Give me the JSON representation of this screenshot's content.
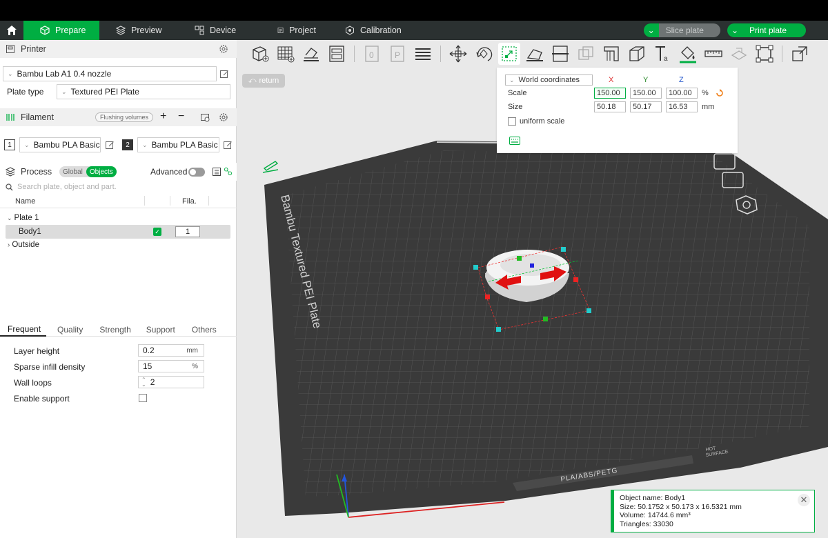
{
  "nav": {
    "tabs": [
      {
        "label": "Prepare"
      },
      {
        "label": "Preview"
      },
      {
        "label": "Device"
      },
      {
        "label": "Project"
      },
      {
        "label": "Calibration"
      }
    ],
    "slice_label": "Slice plate",
    "print_label": "Print plate"
  },
  "printer": {
    "title": "Printer",
    "model": "Bambu Lab A1 0.4 nozzle",
    "plate_type_label": "Plate type",
    "plate_type": "Textured PEI Plate"
  },
  "filament": {
    "title": "Filament",
    "flushing_label": "Flushing volumes",
    "plus": "+",
    "minus": "−",
    "slots": [
      {
        "num": "1",
        "name": "Bambu PLA Basic"
      },
      {
        "num": "2",
        "name": "Bambu PLA Basic"
      }
    ]
  },
  "process": {
    "title": "Process",
    "global_label": "Global",
    "objects_label": "Objects",
    "advanced_label": "Advanced",
    "search_placeholder": "Search plate, object and part.",
    "col_name": "Name",
    "col_fila": "Fila.",
    "plate": "Plate 1",
    "body": "Body1",
    "body_fila": "1",
    "outside": "Outside"
  },
  "settings": {
    "tabs": [
      "Frequent",
      "Quality",
      "Strength",
      "Support",
      "Others"
    ],
    "layer_height_label": "Layer height",
    "layer_height": "0.2",
    "layer_height_unit": "mm",
    "infill_label": "Sparse infill density",
    "infill": "15",
    "infill_unit": "%",
    "wall_label": "Wall loops",
    "wall": "2",
    "support_label": "Enable support"
  },
  "viewport": {
    "return_label": "return",
    "plate_label": "Bambu Textured PEI Plate",
    "plate_material": "PLA/ABS/PETG",
    "hot_surface_1": "HOT",
    "hot_surface_2": "SURFACE"
  },
  "scale_panel": {
    "coords": "World coordinates",
    "x": "X",
    "y": "Y",
    "z": "Z",
    "scale_label": "Scale",
    "scale_x": "150.00",
    "scale_y": "150.00",
    "scale_z": "100.00",
    "scale_unit": "%",
    "size_label": "Size",
    "size_x": "50.18",
    "size_y": "50.17",
    "size_z": "16.53",
    "size_unit": "mm",
    "uniform_label": "uniform scale"
  },
  "object_info": {
    "name": "Object name: Body1",
    "size": "Size: 50.1752 x 50.173 x 16.5321 mm",
    "volume": "Volume: 14744.6 mm³",
    "triangles": "Triangles: 33030"
  },
  "colors": {
    "accent": "#00ae42",
    "nav_bg": "#2b3131",
    "plate": "#3a3a3a"
  }
}
